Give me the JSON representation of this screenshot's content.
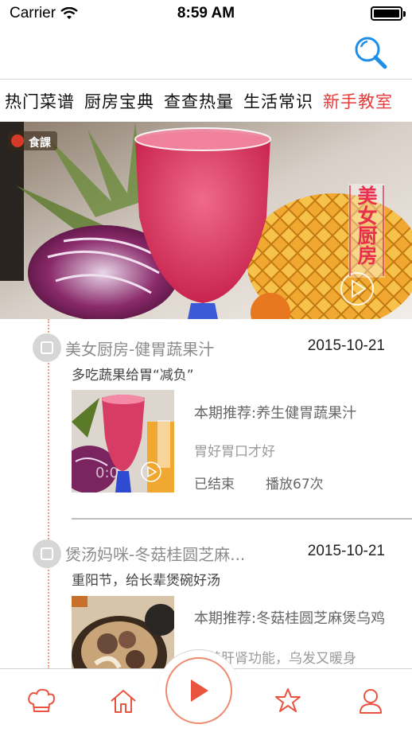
{
  "status_bar": {
    "carrier": "Carrier",
    "time": "8:59 AM"
  },
  "nav": {
    "search_icon": "search-icon"
  },
  "tabs": [
    {
      "label": "热门菜谱",
      "active": false
    },
    {
      "label": "厨房宝典",
      "active": false
    },
    {
      "label": "查查热量",
      "active": false
    },
    {
      "label": "生活常识",
      "active": false
    },
    {
      "label": "新手教室",
      "active": true
    }
  ],
  "banner": {
    "show_label": "美女厨房",
    "logo_text": "食課"
  },
  "feed": [
    {
      "title": "美女厨房-健胃蔬果汁",
      "date": "2015-10-21",
      "subtitle": "多吃蔬果给胃“减负”",
      "recommend": "本期推荐:养生健胃蔬果汁",
      "description": "胃好胃口才好",
      "status": "已结束",
      "plays": "播放67次"
    },
    {
      "title": "煲汤妈咪-冬菇桂圆芝麻...",
      "date": "2015-10-21",
      "subtitle": "重阳节，给长辈煲碗好汤",
      "recommend": "本期推荐:冬菇桂圆芝麻煲乌鸡",
      "description": "滋养肝肾功能，乌发又暖身"
    }
  ],
  "tabbar": {
    "items": [
      "chef-hat-icon",
      "home-icon",
      "play-icon",
      "star-icon",
      "user-icon"
    ],
    "accent": "#e8543f"
  },
  "colors": {
    "accent": "#e63b3b",
    "timeline": "#f29b7a",
    "search": "#1e8fe8"
  }
}
